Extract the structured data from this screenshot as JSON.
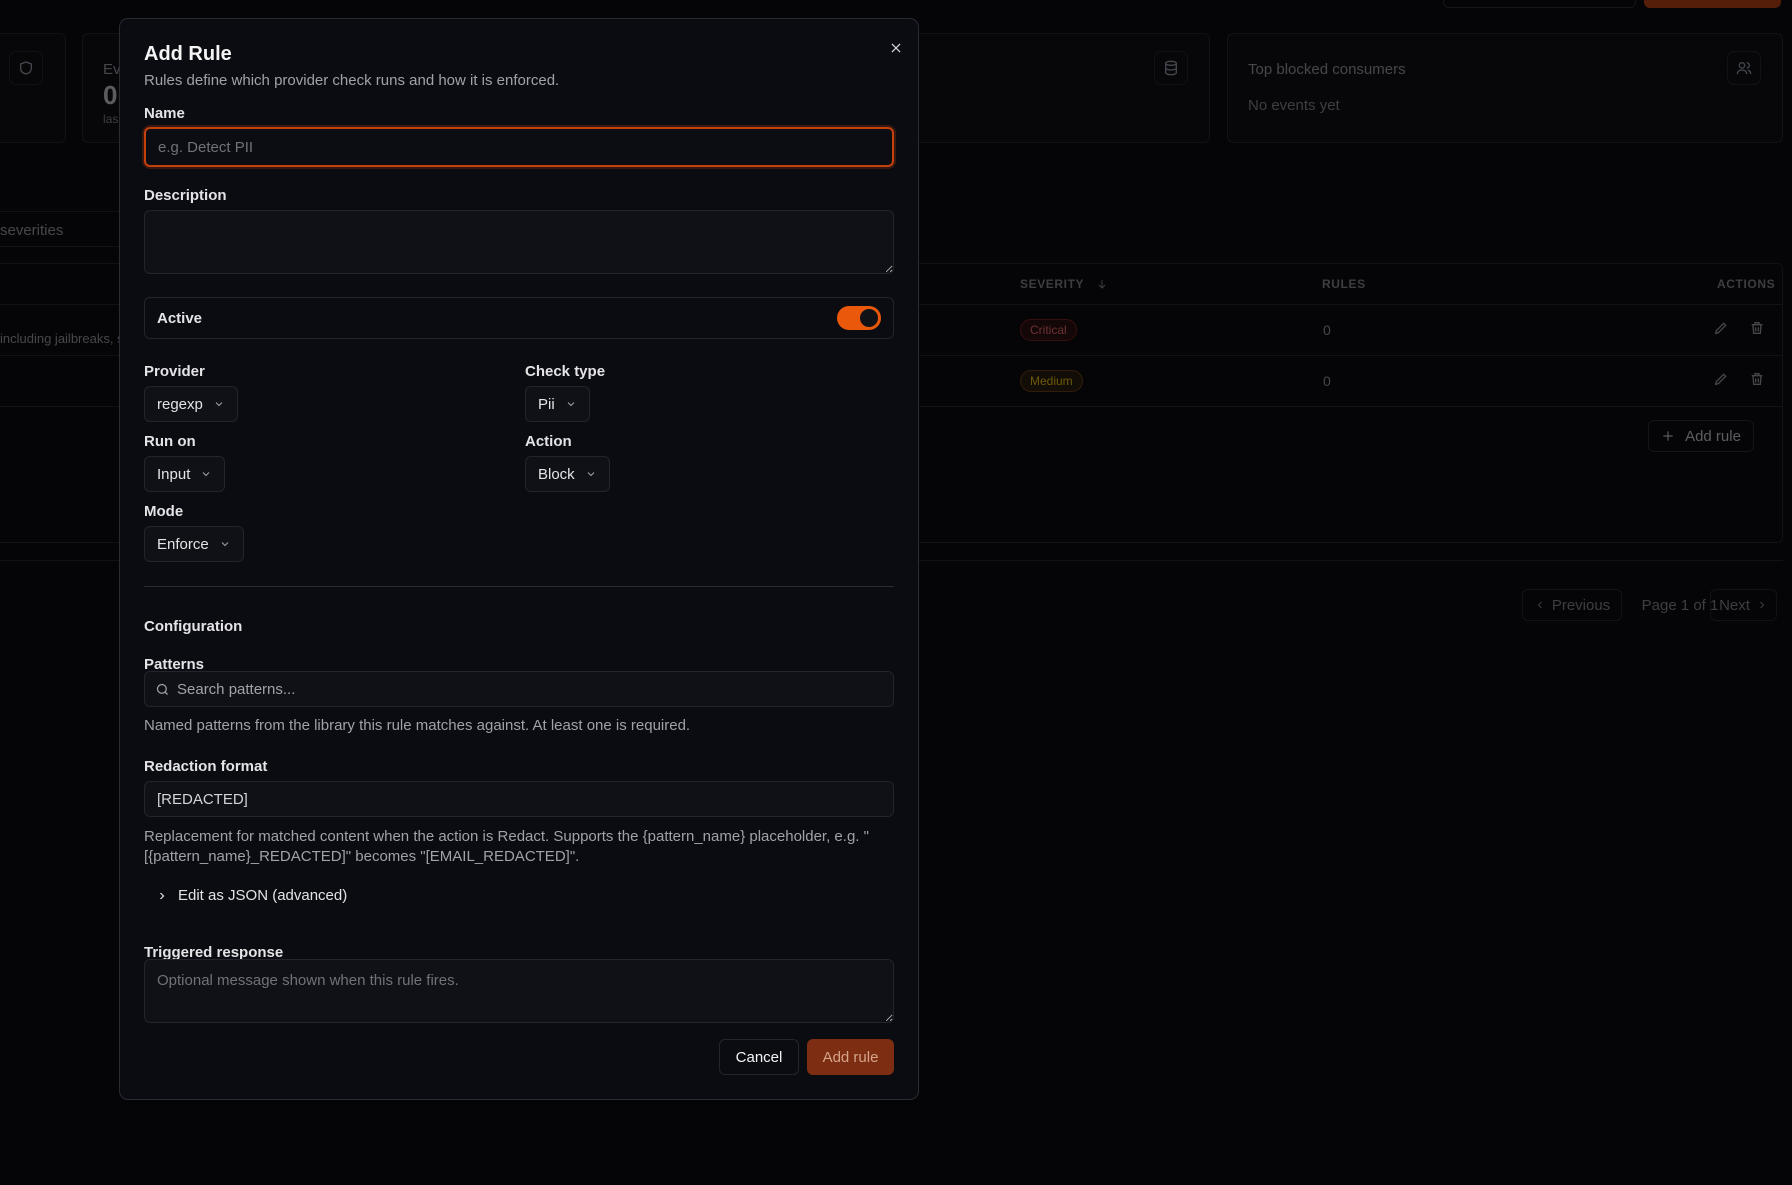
{
  "background": {
    "cards": [
      {
        "title": "Ev",
        "value": "0",
        "sub": "las"
      },
      {
        "title": "Top blocked consumers",
        "sub": "No events yet"
      }
    ],
    "severity_filter": "severities",
    "table": {
      "columns": {
        "severity": "SEVERITY",
        "rules": "RULES",
        "actions": "ACTIONS"
      },
      "rows": [
        {
          "desc_fragment": "including jailbreaks, s",
          "severity": "Critical",
          "rules": "0"
        },
        {
          "desc_fragment": "",
          "severity": "Medium",
          "rules": "0"
        }
      ],
      "add_rule_label": "Add rule"
    },
    "pagination": {
      "previous": "Previous",
      "page": "Page 1 of 1",
      "next": "Next"
    }
  },
  "modal": {
    "title": "Add Rule",
    "description": "Rules define which provider check runs and how it is enforced.",
    "name": {
      "label": "Name",
      "placeholder": "e.g. Detect PII",
      "value": ""
    },
    "description_field": {
      "label": "Description",
      "value": ""
    },
    "active": {
      "label": "Active",
      "on": true
    },
    "provider": {
      "label": "Provider",
      "value": "regexp"
    },
    "check_type": {
      "label": "Check type",
      "value": "Pii"
    },
    "run_on": {
      "label": "Run on",
      "value": "Input"
    },
    "action": {
      "label": "Action",
      "value": "Block"
    },
    "mode": {
      "label": "Mode",
      "value": "Enforce"
    },
    "configuration": {
      "title": "Configuration",
      "patterns": {
        "label": "Patterns",
        "placeholder": "Search patterns...",
        "help": "Named patterns from the library this rule matches against. At least one is required."
      },
      "redaction": {
        "label": "Redaction format",
        "value": "[REDACTED]",
        "help": "Replacement for matched content when the action is Redact. Supports the {pattern_name} placeholder, e.g. \"[{pattern_name}_REDACTED]\" becomes \"[EMAIL_REDACTED]\"."
      },
      "json_toggle": "Edit as JSON (advanced)"
    },
    "triggered_response": {
      "label": "Triggered response",
      "placeholder": "Optional message shown when this rule fires."
    },
    "buttons": {
      "cancel": "Cancel",
      "submit": "Add rule"
    },
    "colors": {
      "accent": "#ea580c",
      "submit_bg": "#7c2d12",
      "focus_border": "#c2410c"
    }
  }
}
